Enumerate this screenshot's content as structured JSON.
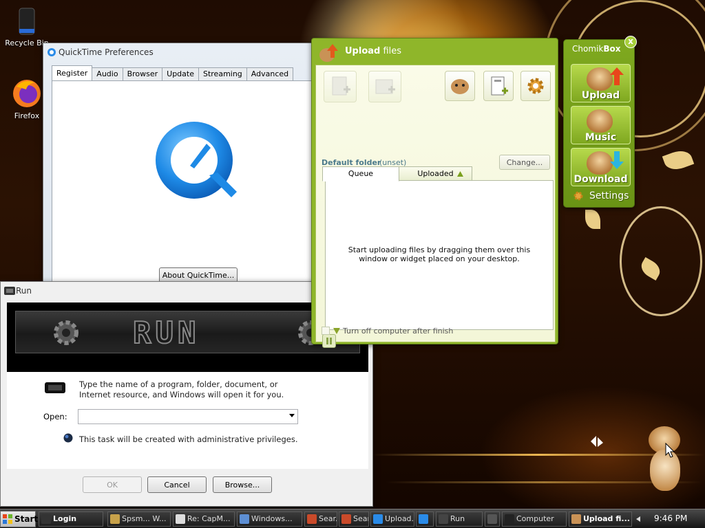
{
  "desktop": {
    "icons": [
      {
        "label": "Recycle Bin",
        "icon": "recycle-bin-icon"
      },
      {
        "label": "Firefox",
        "icon": "firefox-icon"
      }
    ]
  },
  "quicktime": {
    "title": "QuickTime Preferences",
    "tabs": [
      "Register",
      "Audio",
      "Browser",
      "Update",
      "Streaming",
      "Advanced"
    ],
    "active_tab": "Register",
    "about_button": "About QuickTime...",
    "logo_color": "#1e8ae6"
  },
  "run": {
    "title": "Run",
    "banner_text": "RUN",
    "description": "Type the name of a program, folder, document, or Internet resource, and Windows will open it for you.",
    "open_label": "Open:",
    "open_value": "",
    "admin_note": "This task will be created with administrative privileges.",
    "ok": "OK",
    "cancel": "Cancel",
    "browse": "Browse..."
  },
  "upload": {
    "title_bold": "Upload",
    "title_rest": "files",
    "default_folder_label": "Default folder",
    "default_folder_value": "(unset)",
    "change_button": "Change...",
    "tabs": [
      "Queue",
      "Uploaded"
    ],
    "active_tab": "Queue",
    "empty_message": "Start uploading files by dragging them over this window or widget placed on your desktop.",
    "shutdown_label": "Turn off computer after finish",
    "accent": "#8fb62a"
  },
  "chomikbox": {
    "title_light": "Chomik",
    "title_bold": "Box",
    "buttons": [
      "Upload",
      "Music",
      "Download"
    ],
    "settings": "Settings",
    "close": "x"
  },
  "taskbar": {
    "start": "Start",
    "items": [
      "Login",
      "Spsm... W...",
      "Re: CapM...",
      "Windows...",
      "Sear...",
      "Sear...",
      "Upload...",
      "",
      "Run",
      "",
      "Computer",
      "Upload fi..."
    ],
    "clock": "9:46 PM"
  }
}
